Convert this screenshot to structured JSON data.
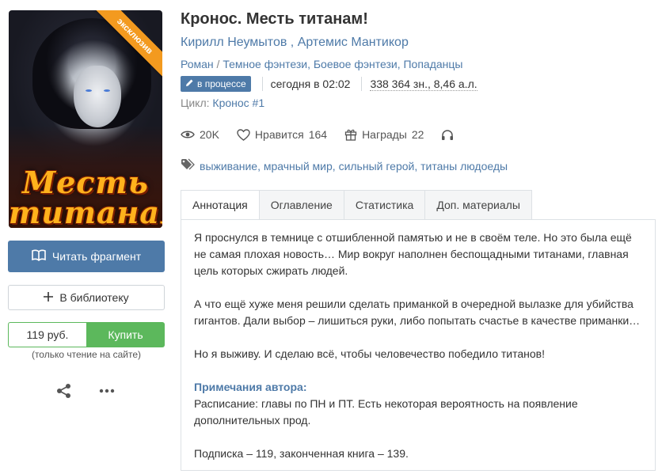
{
  "book": {
    "title": "Кронос. Месть титанам!",
    "authors": [
      "Кирилл Неумытов",
      "Артемис Мантикор"
    ],
    "author_separator": " , ",
    "genre_primary": "Роман",
    "genres": "Темное фэнтези, Боевое фэнтези, Попаданцы",
    "genre_slash": " / ",
    "status": "в процессе",
    "updated": "сегодня в 02:02",
    "size": "338 364 зн., 8,46 а.л.",
    "cycle_label": "Цикл:",
    "cycle_name": "Кронос #1"
  },
  "cover": {
    "title_line1": "Месть",
    "title_line2": "титанам!",
    "ribbon": "эксклюзив"
  },
  "stats": {
    "views": "20K",
    "likes_label": "Нравится",
    "likes": "164",
    "awards_label": "Награды",
    "awards": "22"
  },
  "tags": "выживание, мрачный мир, сильный герой, титаны людоеды",
  "actions": {
    "read_fragment": "Читать фрагмент",
    "add_to_library": "В библиотеку",
    "price": "119 руб.",
    "buy": "Купить",
    "buy_note": "(только чтение на сайте)"
  },
  "tabs": [
    "Аннотация",
    "Оглавление",
    "Статистика",
    "Доп. материалы"
  ],
  "annotation": {
    "p1": "Я проснулся в темнице с отшибленной памятью и не в своём теле. Но это была ещё не самая плохая новость… Мир вокруг наполнен беспощадными титанами, главная цель которых сжирать людей.",
    "p2": "А что ещё хуже меня решили сделать приманкой в очередной вылазке для убийства гигантов. Дали выбор – лишиться руки, либо попытать счастье в качестве приманки…",
    "p3": "Но я выживу. И сделаю всё, чтобы человечество победило титанов!",
    "notes_title": "Примечания автора:",
    "notes": "Расписание: главы по ПН и ПТ. Есть некоторая вероятность на появление дополнительных прод.",
    "subscription": "Подписка – 119, законченная книга – 139."
  },
  "colors": {
    "link": "#4e7aa8",
    "primary_button": "#4e7aa8",
    "buy_button": "#5cb85c",
    "ribbon": "#f39a1f"
  },
  "icons": [
    "book-icon",
    "plus-icon",
    "share-icon",
    "more-icon",
    "eye-icon",
    "heart-icon",
    "gift-icon",
    "headphones-icon",
    "tag-icon",
    "pencil-icon"
  ]
}
